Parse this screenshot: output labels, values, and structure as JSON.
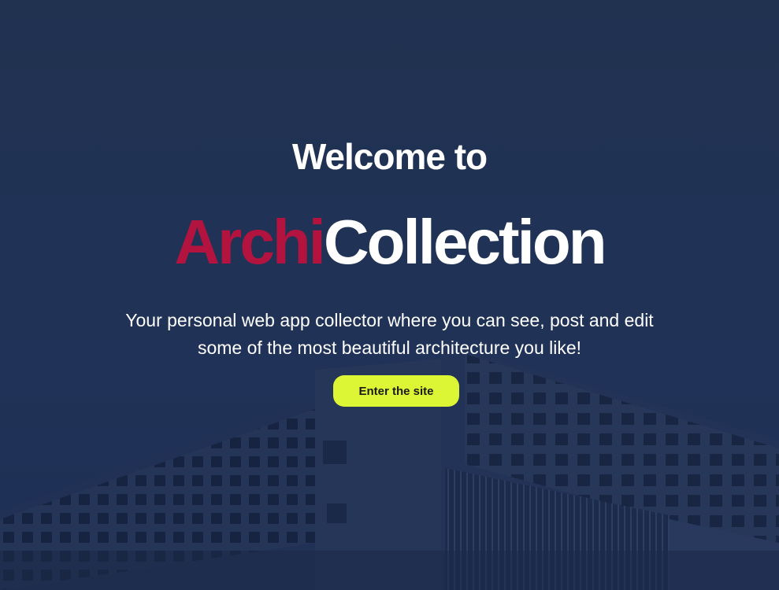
{
  "hero": {
    "welcome": "Welcome to",
    "brand_accent": "Archi",
    "brand_main": "Collection",
    "tagline_line1": "Your personal web app collector where you can see, post and edit",
    "tagline_line2": "some of the most beautiful architecture you like!",
    "cta_label": "Enter the site"
  },
  "colors": {
    "background": "#24344f",
    "brand_accent": "#b3143f",
    "text": "#ffffff",
    "cta_bg": "#dcf534"
  }
}
